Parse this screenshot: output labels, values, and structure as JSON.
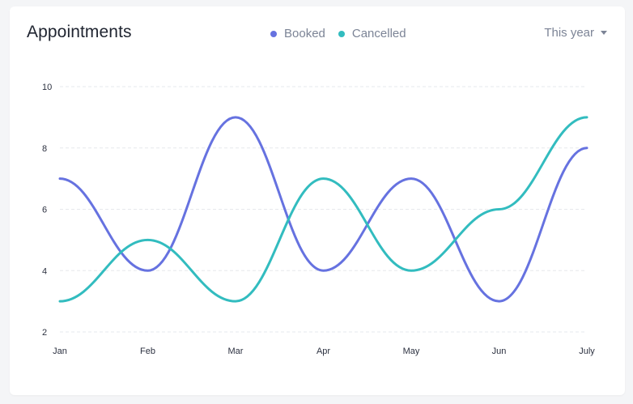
{
  "header": {
    "title": "Appointments",
    "period": "This year",
    "caret_icon": "caret-down-icon"
  },
  "colors": {
    "booked": "#6672e0",
    "cancelled": "#32bcbf",
    "grid": "#e6e8ec"
  },
  "chart_data": {
    "type": "line",
    "title": "Appointments",
    "categories": [
      "Jan",
      "Feb",
      "Mar",
      "Apr",
      "May",
      "Jun",
      "July"
    ],
    "series": [
      {
        "name": "Booked",
        "values": [
          7,
          4,
          9,
          4,
          7,
          3,
          8
        ]
      },
      {
        "name": "Cancelled",
        "values": [
          3,
          5,
          3,
          7,
          4,
          6,
          9
        ]
      }
    ],
    "yticks": [
      2,
      4,
      6,
      8,
      10
    ],
    "ylim": [
      2,
      10
    ],
    "grid": true,
    "legend": "top-center",
    "smooth": true
  }
}
